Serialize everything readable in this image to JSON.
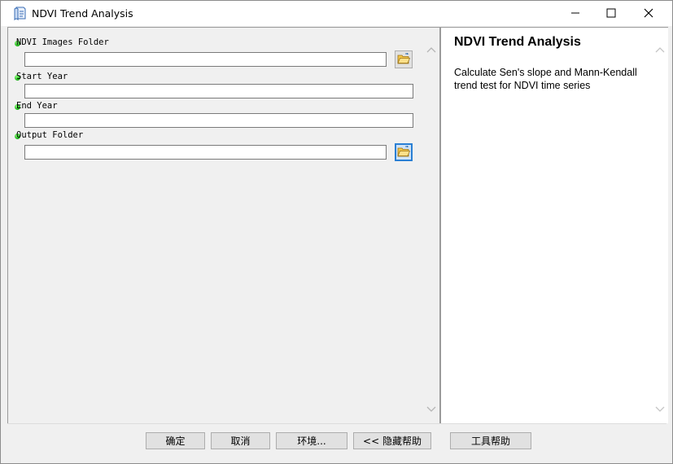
{
  "window": {
    "title": "NDVI Trend Analysis",
    "icon": "script-tool-icon"
  },
  "params": [
    {
      "label": "NDVI Images Folder",
      "value": "",
      "has_browse": true
    },
    {
      "label": "Start Year",
      "value": "",
      "has_browse": false
    },
    {
      "label": "End Year",
      "value": "",
      "has_browse": false
    },
    {
      "label": "Output Folder",
      "value": "",
      "has_browse": true
    }
  ],
  "help": {
    "title": "NDVI Trend Analysis",
    "description": "Calculate Sen's slope and Mann-Kendall trend test for NDVI time series"
  },
  "buttons": {
    "ok": "确定",
    "cancel": "取消",
    "environments": "环境...",
    "hide_help": "<< 隐藏帮助",
    "tool_help": "工具帮助"
  },
  "colors": {
    "required_dot": "#1fb81b",
    "focus_border": "#2a7fd4",
    "panel_bg": "#f0f0f0"
  }
}
